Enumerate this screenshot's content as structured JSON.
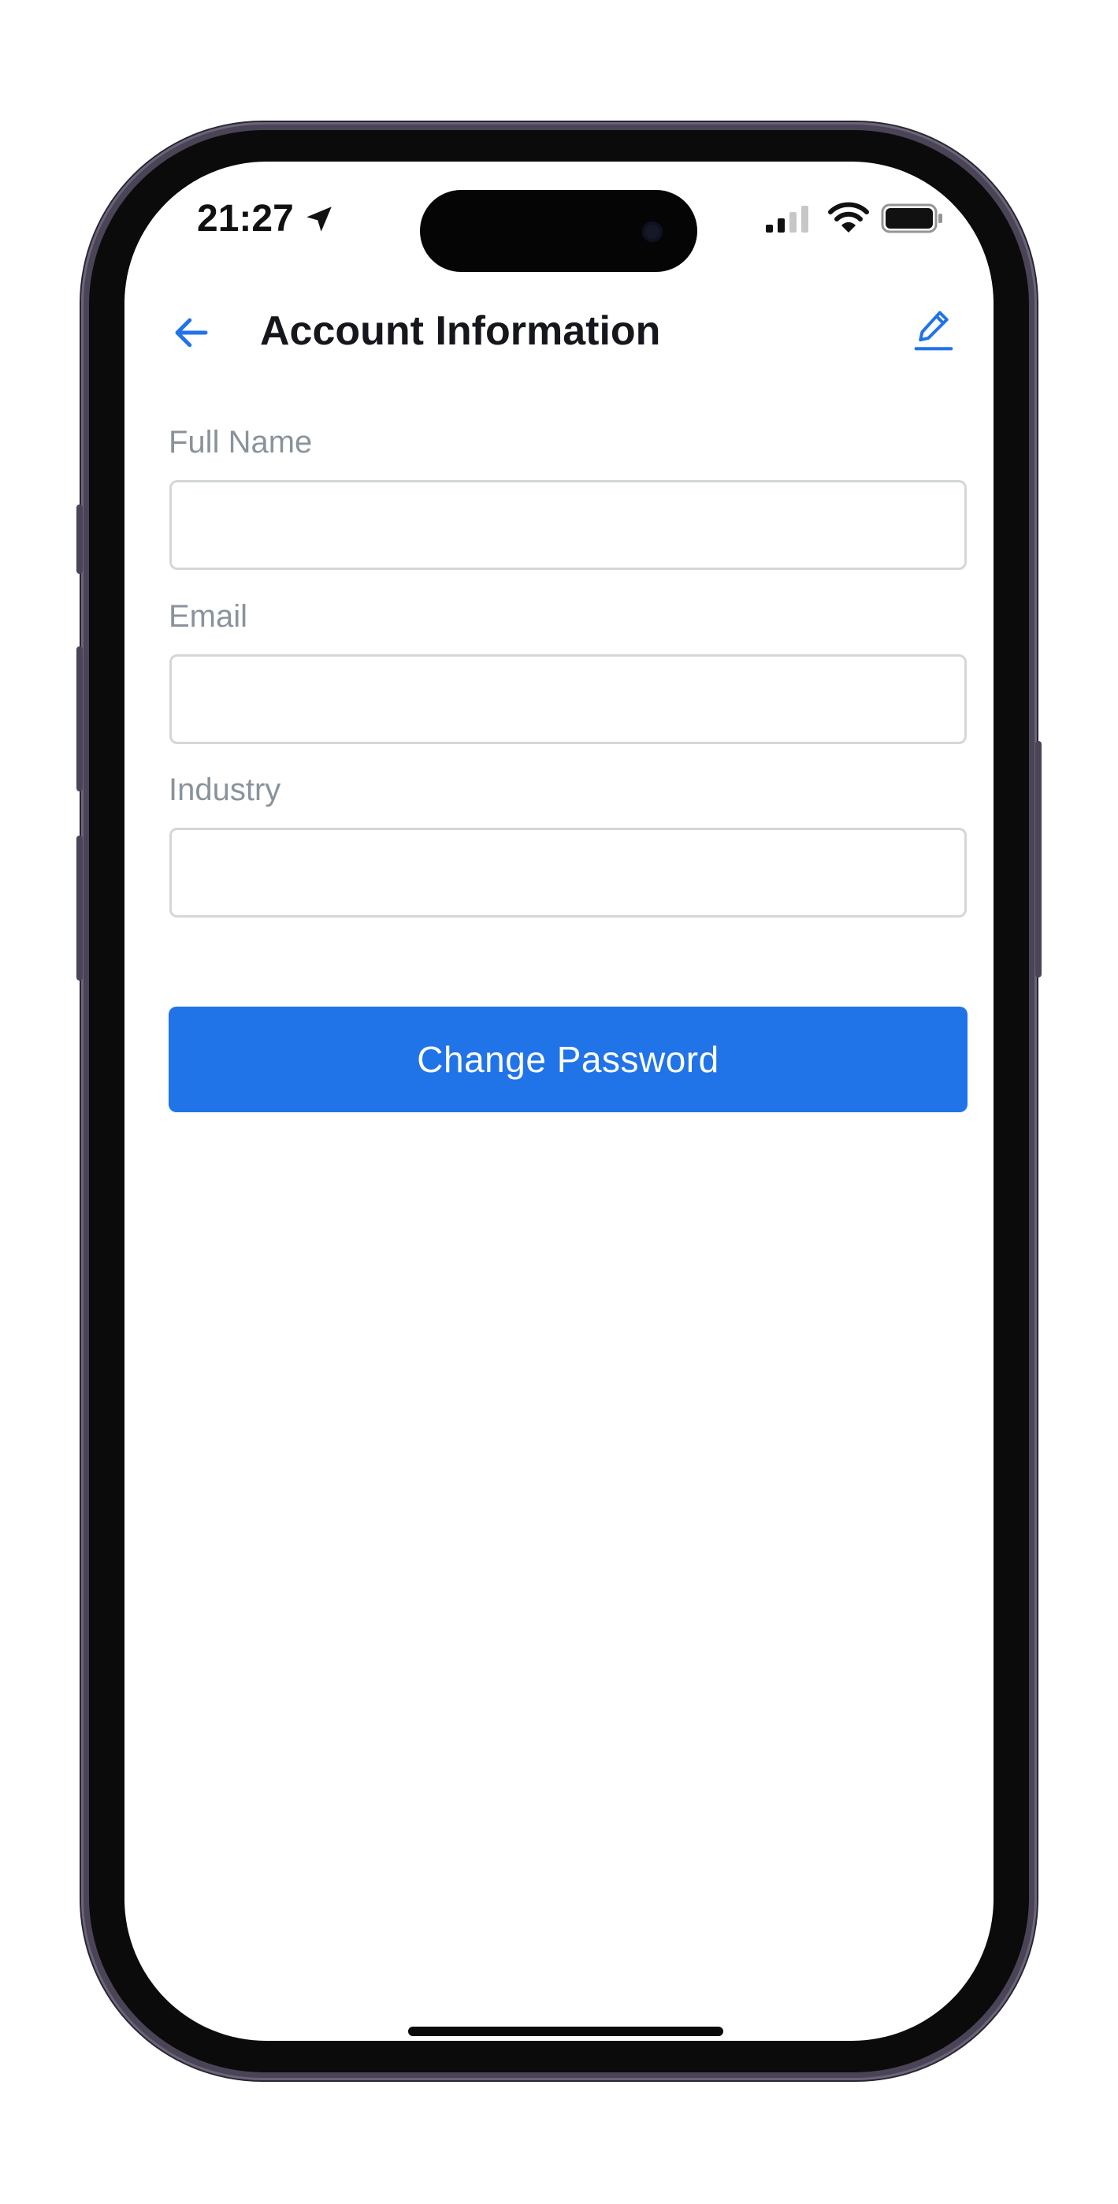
{
  "status_bar": {
    "time": "21:27",
    "icons": [
      "location-arrow-icon",
      "cellular-signal-icon",
      "wifi-icon",
      "battery-icon"
    ]
  },
  "header": {
    "title": "Account Information",
    "back_icon": "arrow-left-icon",
    "edit_icon": "pencil-icon"
  },
  "form": {
    "full_name": {
      "label": "Full Name",
      "value": "",
      "placeholder": ""
    },
    "email": {
      "label": "Email",
      "value": "",
      "placeholder": ""
    },
    "industry": {
      "label": "Industry",
      "value": "",
      "placeholder": ""
    }
  },
  "actions": {
    "change_password_label": "Change Password"
  },
  "colors": {
    "accent": "#2173E8",
    "label_gray": "#8A939C",
    "input_border": "#D3D7DA",
    "title": "#15171C"
  }
}
